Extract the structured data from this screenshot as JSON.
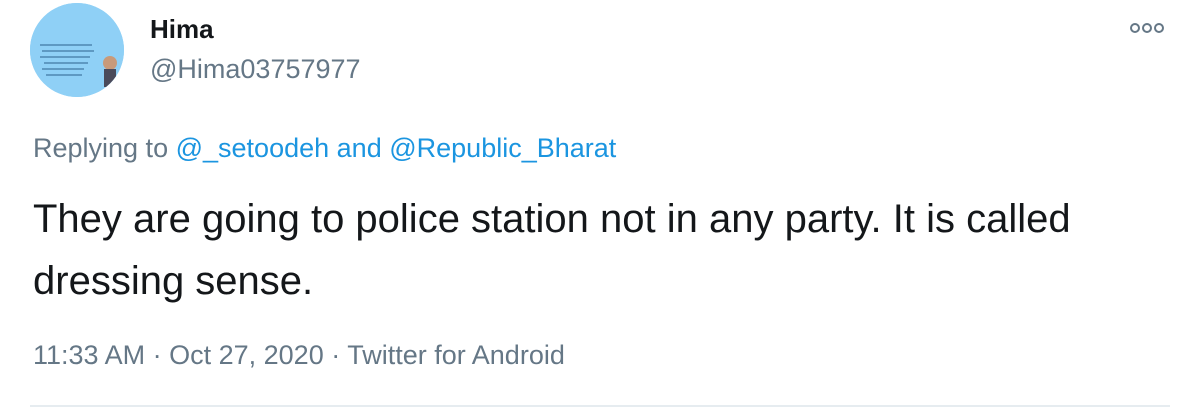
{
  "tweet": {
    "display_name": "Hima",
    "handle": "@Hima03757977",
    "avatar_icon": "profile-avatar",
    "more_icon": "more-options-icon",
    "replying": {
      "prefix": "Replying to",
      "mention1": "@_setoodeh",
      "joiner": "and",
      "mention2": "@Republic_Bharat"
    },
    "text": "They are going to police station not in any party. It is called dressing sense.",
    "time": "11:33 AM",
    "separator": "·",
    "date": "Oct 27, 2020",
    "source": "Twitter for Android"
  },
  "colors": {
    "link": "#1b95e0",
    "secondary": "#657786",
    "primary": "#14171a",
    "avatar_bg": "#8fd0f6"
  }
}
